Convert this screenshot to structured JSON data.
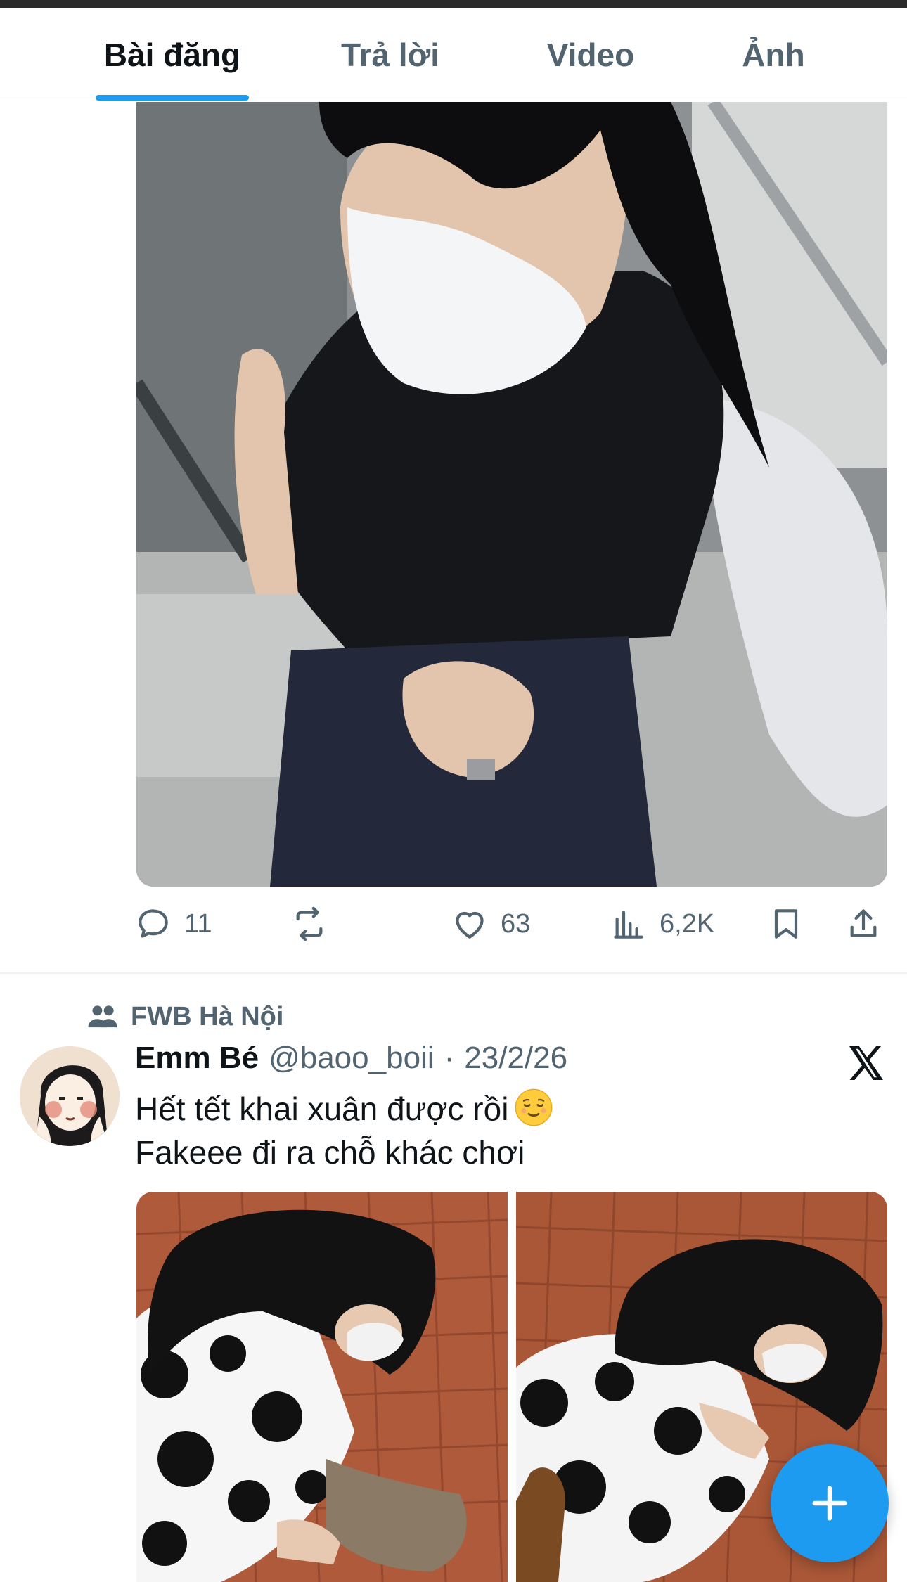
{
  "tabs": [
    {
      "label": "Bài đăng",
      "active": true
    },
    {
      "label": "Trả lời",
      "active": false
    },
    {
      "label": "Video",
      "active": false
    },
    {
      "label": "Ảnh",
      "active": false
    }
  ],
  "previous_post": {
    "image_icon": "photo",
    "actions": {
      "replies": "11",
      "reposts": "",
      "likes": "63",
      "views": "6,2K"
    },
    "action_icons": [
      "reply-icon",
      "repost-icon",
      "like-icon",
      "views-icon",
      "bookmark-icon",
      "share-icon"
    ]
  },
  "post": {
    "group_icon": "people-icon",
    "group_name": "FWB Hà Nội",
    "author_name": "Emm Bé",
    "handle": "@baoo_boii",
    "separator": "·",
    "date": "23/2/26",
    "source_icon": "x-logo-icon",
    "text_line_1": "Hết tết khai xuân được rồi",
    "text_line_2": "Fakeee đi ra chỗ khác chơi",
    "emoji": "relieved-face-emoji"
  },
  "fab_icon": "plus-icon",
  "colors": {
    "accent": "#1d9bf0",
    "text": "#0f1419",
    "secondary": "#536471"
  }
}
